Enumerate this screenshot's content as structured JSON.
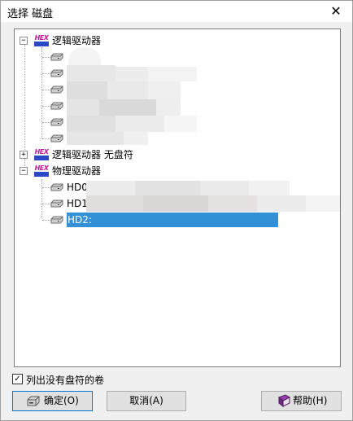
{
  "window": {
    "title": "选择 磁盘",
    "close_glyph": "✕"
  },
  "tree": {
    "root_logical": {
      "label": "逻辑驱动器",
      "expander": "−"
    },
    "root_logical_no_letter": {
      "label": "逻辑驱动器 无盘符",
      "expander": "+"
    },
    "root_physical": {
      "label": "物理驱动器",
      "expander": "−"
    },
    "physical_items": [
      {
        "label": "HD0"
      },
      {
        "label": "HD1"
      },
      {
        "label": "HD2:"
      }
    ]
  },
  "options": {
    "list_without_letter": {
      "label": "列出没有盘符的卷",
      "checked": true,
      "check_glyph": "✓"
    }
  },
  "buttons": {
    "ok": "确定(O)",
    "cancel": "取消(A)",
    "help": "帮助(H)"
  },
  "colors": {
    "selection": "#3291d6",
    "hex_magenta": "#c01891",
    "hex_blue": "#2a47c8",
    "focus_border": "#0078d7"
  },
  "icons": {
    "hex_label": "HEX"
  }
}
